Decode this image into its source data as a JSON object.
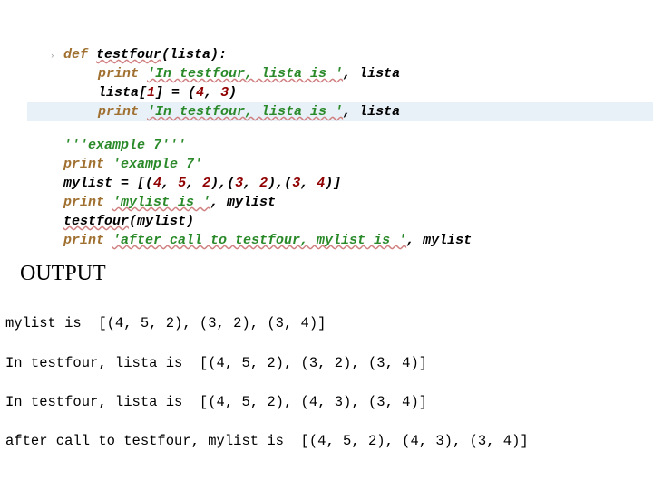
{
  "code": {
    "line1": {
      "kw": "def ",
      "fn": "testfour",
      "rest": "(lista):"
    },
    "line2": {
      "kw": "print ",
      "str": "'In testfour, lista is '",
      "rest": ", lista"
    },
    "line3": {
      "pre": "lista[",
      "n1": "1",
      "mid": "] = (",
      "n2": "4",
      "comma": ", ",
      "n3": "3",
      "end": ")"
    },
    "line4": {
      "kw": "print ",
      "str": "'In testfour, lista is '",
      "rest": ", lista"
    },
    "line5": {
      "str": "'''example 7'''"
    },
    "line6": {
      "kw": "print ",
      "str": "'example 7'"
    },
    "line7": {
      "pre": "mylist = [(",
      "n1": "4",
      "c1": ", ",
      "n2": "5",
      "c2": ", ",
      "n3": "2",
      "m1": "),(",
      "n4": "3",
      "c3": ", ",
      "n5": "2",
      "m2": "),(",
      "n6": "3",
      "c4": ", ",
      "n7": "4",
      "end": ")]"
    },
    "line8": {
      "kw": "print ",
      "str": "'mylist is '",
      "rest": ", mylist"
    },
    "line9": {
      "fn": "testfour",
      "rest": "(mylist)"
    },
    "line10": {
      "kw": "print ",
      "str": "'after call to testfour, mylist is '",
      "rest": ", mylist"
    }
  },
  "output_label": "OUTPUT",
  "output": {
    "l1": "mylist is  [(4, 5, 2), (3, 2), (3, 4)]",
    "l2": "In testfour, lista is  [(4, 5, 2), (3, 2), (3, 4)]",
    "l3": "In testfour, lista is  [(4, 5, 2), (4, 3), (3, 4)]",
    "l4": "after call to testfour, mylist is  [(4, 5, 2), (4, 3), (3, 4)]"
  }
}
